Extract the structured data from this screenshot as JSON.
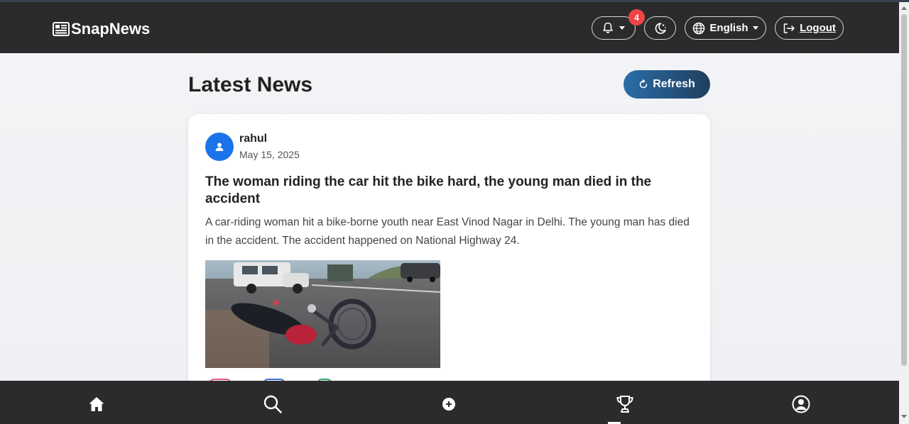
{
  "header": {
    "brand": "SnapNews",
    "notifications_count": "4",
    "language": "English",
    "logout_label": "Logout"
  },
  "main": {
    "title": "Latest News",
    "refresh_label": "Refresh"
  },
  "post": {
    "author": "rahul",
    "date": "May 15, 2025",
    "headline": "The woman riding the car hit the bike hard, the young man died in the accident",
    "summary": "A car-riding woman hit a bike-borne youth near East Vinod Nagar in Delhi. The young man has died in the accident. The accident happened on National Highway 24."
  },
  "bottom_nav": {
    "items": [
      "home-icon",
      "search-icon",
      "add-icon",
      "trophy-icon",
      "profile-icon"
    ],
    "active": "trophy-icon"
  },
  "colors": {
    "header_bg": "#2b2b2d",
    "badge": "#ee4444",
    "avatar": "#1a73e8",
    "refresh_start": "#2a6da8",
    "refresh_end": "#1f3f5e"
  }
}
